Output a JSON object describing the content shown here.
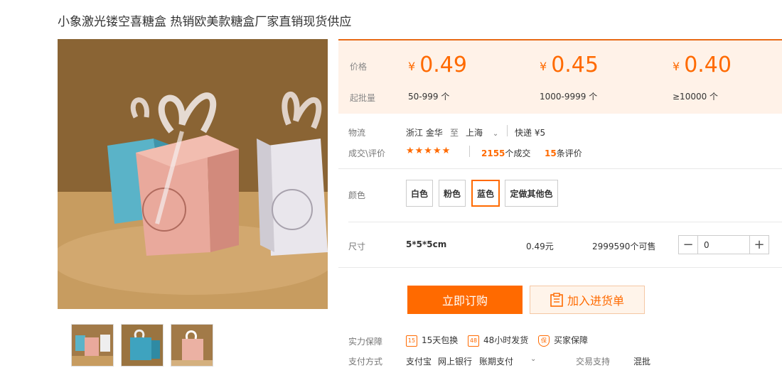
{
  "title": "小象激光镂空喜糖盒 热销欧美款糖盒厂家直销现货供应",
  "price": {
    "label_price": "价格",
    "label_moq": "起批量",
    "currency": "¥",
    "tiers": [
      {
        "price": "0.49",
        "range": "50-999 个"
      },
      {
        "price": "0.45",
        "range": "1000-9999 个"
      },
      {
        "price": "0.40",
        "range": "≥10000 个"
      }
    ]
  },
  "logistics": {
    "label": "物流",
    "from": "浙江 金华",
    "to_word": "至",
    "to": "上海",
    "shipping": "快递 ¥5"
  },
  "reviews": {
    "label": "成交\\评价",
    "stars": "★★★★★",
    "deals_count": "2155",
    "deals_suffix": "个成交",
    "review_count": "15",
    "review_suffix": "条评价"
  },
  "color": {
    "label": "颜色",
    "options": [
      "白色",
      "粉色",
      "蓝色",
      "定做其他色"
    ],
    "selected": "蓝色"
  },
  "size": {
    "label": "尺寸",
    "value": "5*5*5cm",
    "unit_price": "0.49元",
    "stock": "2999590个可售",
    "quantity": "0"
  },
  "actions": {
    "buy_now": "立即订购",
    "add_cart": "加入进货单"
  },
  "guarantee": {
    "label": "实力保障",
    "items": [
      {
        "icon": "15",
        "text": "15天包换"
      },
      {
        "icon": "48",
        "text": "48小时发货"
      },
      {
        "icon": "保",
        "text": "买家保障"
      }
    ]
  },
  "payment": {
    "label": "支付方式",
    "methods": [
      "支付宝",
      "网上银行",
      "账期支付"
    ],
    "trade_label": "交易支持",
    "trade_value": "混批"
  },
  "colors": {
    "accent": "#ff6a00",
    "price_bg": "#fff2e8"
  }
}
